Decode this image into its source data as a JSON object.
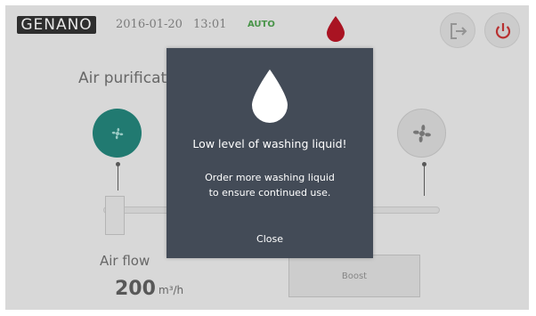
{
  "header": {
    "logo_text": "GENANO",
    "date": "2016-01-20",
    "time": "13:01",
    "mode": "AUTO",
    "icons": {
      "liquid": "droplet-icon",
      "logout": "logout-icon",
      "power": "power-icon"
    }
  },
  "main": {
    "section_title": "Air purification",
    "air_flow": {
      "label": "Air flow",
      "value": "200",
      "unit": "m³/h"
    },
    "boost_label": "Boost",
    "icons": {
      "fan_left": "fan-icon",
      "fan_right": "fan-icon"
    }
  },
  "dialog": {
    "icon": "droplet-icon",
    "title": "Low level of washing liquid!",
    "message_line1": "Order more washing liquid",
    "message_line2": "to ensure continued use.",
    "close_label": "Close"
  },
  "colors": {
    "background": "#e2e2e2",
    "dialog_bg": "#434b57",
    "accent_teal": "#1f7e74",
    "alert_red": "#b01020",
    "mode_green": "#4a9a4a"
  }
}
